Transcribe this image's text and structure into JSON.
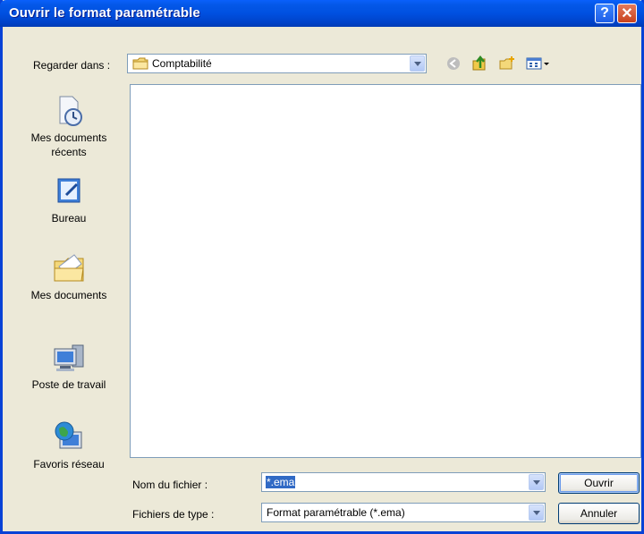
{
  "window": {
    "title": "Ouvrir le format paramétrable"
  },
  "titlebar": {
    "help_label": "?",
    "close_label": "✕"
  },
  "lookin": {
    "label": "Regarder dans :",
    "value": "Comptabilité"
  },
  "places": [
    {
      "label": "Mes documents récents",
      "icon": "recent-documents-icon"
    },
    {
      "label": "Bureau",
      "icon": "desktop-icon"
    },
    {
      "label": "Mes documents",
      "icon": "my-documents-icon"
    },
    {
      "label": "Poste de travail",
      "icon": "my-computer-icon"
    },
    {
      "label": "Favoris réseau",
      "icon": "network-places-icon"
    }
  ],
  "filename": {
    "label": "Nom du fichier :",
    "value": "*.ema"
  },
  "filetype": {
    "label": "Fichiers de type :",
    "value": "Format paramétrable (*.ema)"
  },
  "buttons": {
    "open": "Ouvrir",
    "cancel": "Annuler"
  },
  "colors": {
    "titlebar": "#0050E0",
    "face": "#ECE9D8",
    "border": "#7F9DB9"
  }
}
